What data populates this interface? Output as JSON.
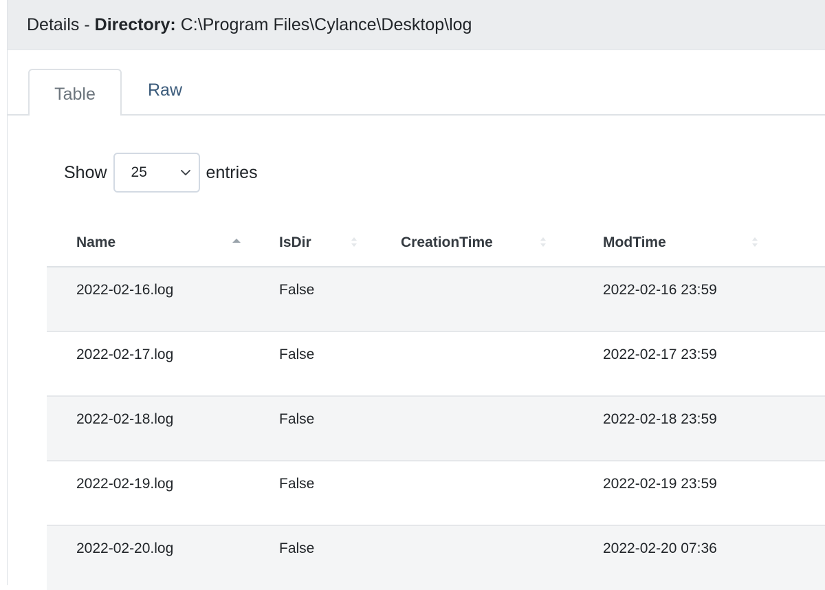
{
  "header": {
    "prefix": "Details",
    "separator": " - ",
    "directory_label": "Directory:",
    "directory_path": "C:\\Program Files\\Cylance\\Desktop\\log"
  },
  "tabs": [
    {
      "label": "Table",
      "active": true
    },
    {
      "label": "Raw",
      "active": false
    }
  ],
  "length_control": {
    "show_label": "Show",
    "selected_value": "25",
    "entries_label": "entries"
  },
  "table": {
    "columns": [
      "Name",
      "IsDir",
      "CreationTime",
      "ModTime"
    ],
    "sorted_column": "Name",
    "sort_direction": "ascending",
    "rows": [
      {
        "name": "2022-02-16.log",
        "isdir": "False",
        "creation": "",
        "mod": "2022-02-16 23:59"
      },
      {
        "name": "2022-02-17.log",
        "isdir": "False",
        "creation": "",
        "mod": "2022-02-17 23:59"
      },
      {
        "name": "2022-02-18.log",
        "isdir": "False",
        "creation": "",
        "mod": "2022-02-18 23:59"
      },
      {
        "name": "2022-02-19.log",
        "isdir": "False",
        "creation": "",
        "mod": "2022-02-19 23:59"
      },
      {
        "name": "2022-02-20.log",
        "isdir": "False",
        "creation": "",
        "mod": "2022-02-20 07:36"
      }
    ]
  },
  "colors": {
    "header_bg": "#ebedef",
    "striped_row_bg": "#f4f5f6",
    "tab_link": "#3a5a7a",
    "border": "#dee2e6"
  }
}
